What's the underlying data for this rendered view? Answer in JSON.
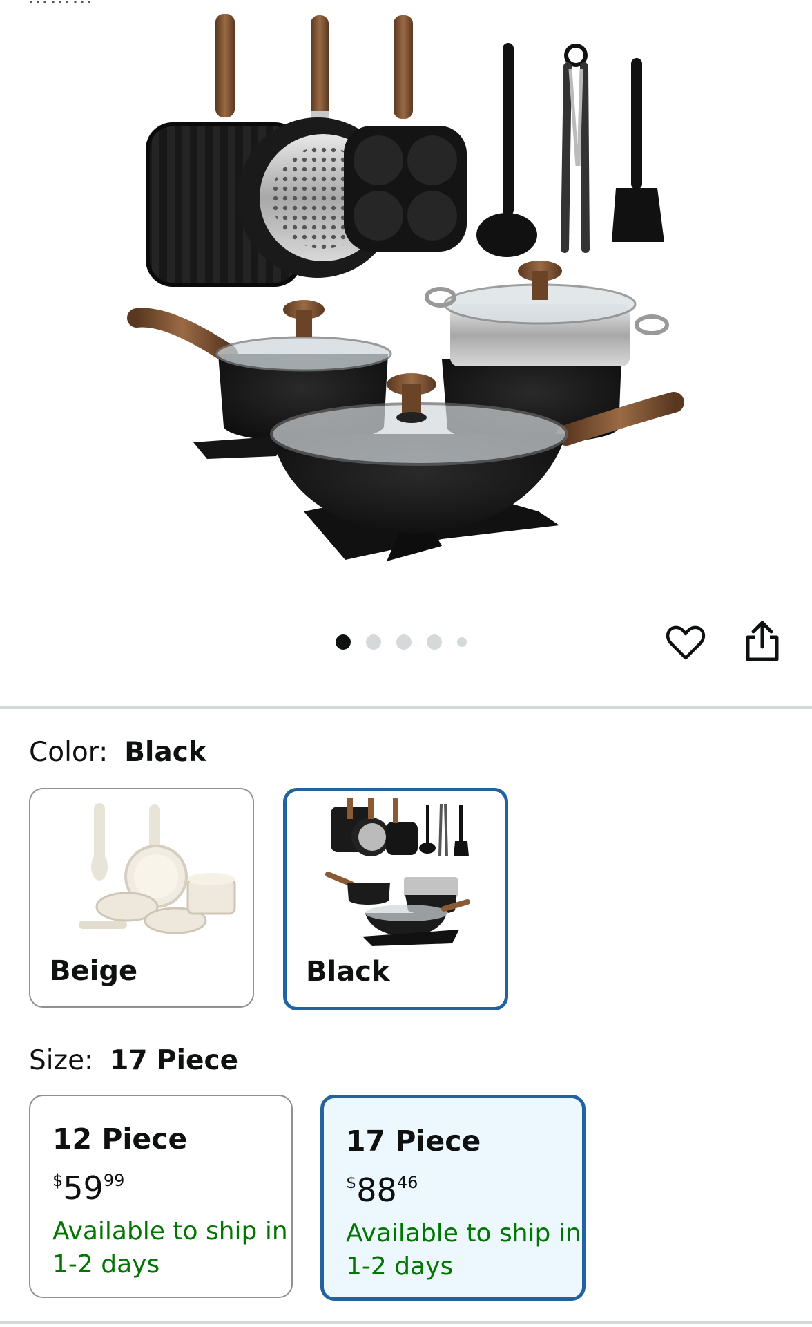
{
  "product": {
    "image_alt": "17 piece black granite cookware set with wood-grain handles",
    "carousel": {
      "count": 5,
      "active_index": 0
    }
  },
  "actions": {
    "wishlist_icon": "heart-outline-icon",
    "share_icon": "share-icon"
  },
  "color": {
    "label": "Color:",
    "selected": "Black",
    "options": [
      {
        "name": "Beige",
        "selected": false
      },
      {
        "name": "Black",
        "selected": true
      }
    ]
  },
  "size": {
    "label": "Size:",
    "selected": "17 Piece",
    "options": [
      {
        "name": "12 Piece",
        "currency": "$",
        "price_whole": "59",
        "price_fraction": "99",
        "availability": "Available to ship in 1-2 days",
        "selected": false
      },
      {
        "name": "17 Piece",
        "currency": "$",
        "price_whole": "88",
        "price_fraction": "46",
        "availability": "Available to ship in 1-2 days",
        "selected": true
      }
    ]
  },
  "colors": {
    "accent": "#2162a1",
    "selected_bg": "#edf8fe",
    "availability": "#007600",
    "border": "#8d9096"
  }
}
